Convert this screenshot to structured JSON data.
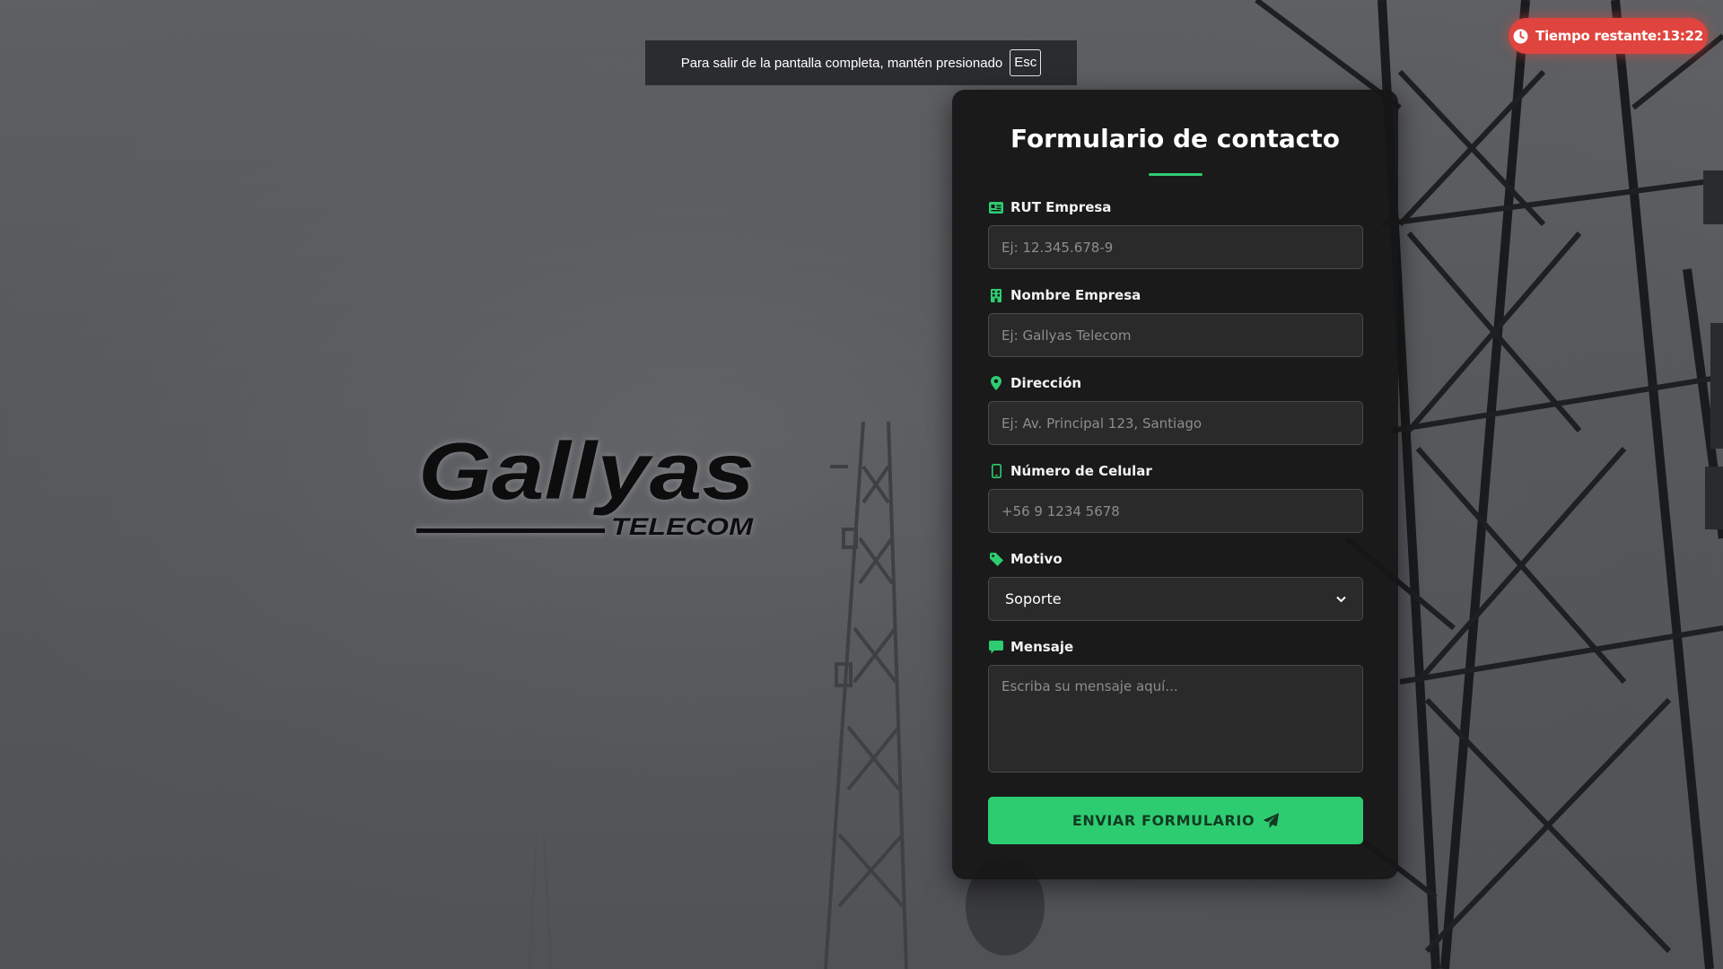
{
  "fullscreen_notice": {
    "text": "Para salir de la pantalla completa, mantén presionado",
    "key": "Esc"
  },
  "timer": {
    "icon": "clock-icon",
    "label": "Tiempo restante:13:22"
  },
  "logo": {
    "name": "Gallyas",
    "tagline": "TELECOM"
  },
  "form": {
    "title": "Formulario de contacto",
    "fields": [
      {
        "label": "RUT Empresa",
        "icon": "id-card-icon",
        "placeholder": "Ej: 12.345.678-9",
        "value": ""
      },
      {
        "label": "Nombre Empresa",
        "icon": "building-icon",
        "placeholder": "Ej: Gallyas Telecom",
        "value": ""
      },
      {
        "label": "Dirección",
        "icon": "map-pin-icon",
        "placeholder": "Ej: Av. Principal 123, Santiago",
        "value": ""
      },
      {
        "label": "Número de Celular",
        "icon": "mobile-phone-icon",
        "placeholder": "+56 9 1234 5678",
        "value": ""
      }
    ],
    "reason": {
      "label": "Motivo",
      "icon": "tag-icon",
      "selected": "Soporte"
    },
    "message": {
      "label": "Mensaje",
      "icon": "comment-icon",
      "placeholder": "Escriba su mensaje aquí...",
      "value": ""
    },
    "submit_label": "ENVIAR FORMULARIO",
    "submit_icon": "paper-plane-icon"
  },
  "colors": {
    "accent": "#2ecc71",
    "timer": "#e0443e",
    "card": "#161616"
  }
}
